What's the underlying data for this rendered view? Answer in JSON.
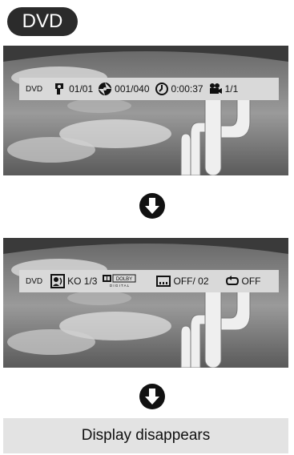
{
  "badge": {
    "label": "DVD"
  },
  "screen1": {
    "osd": {
      "source": "DVD",
      "title": "01/01",
      "chapter": "001/040",
      "time": "0:00:37",
      "angle": "1/1"
    }
  },
  "screen2": {
    "osd": {
      "source": "DVD",
      "audio": "KO 1/3",
      "dolby_line1": "DOLBY",
      "dolby_line2": "D I G I T A L",
      "subtitle": "OFF/  02",
      "repeat": "OFF"
    }
  },
  "footer": {
    "text": "Display disappears"
  }
}
